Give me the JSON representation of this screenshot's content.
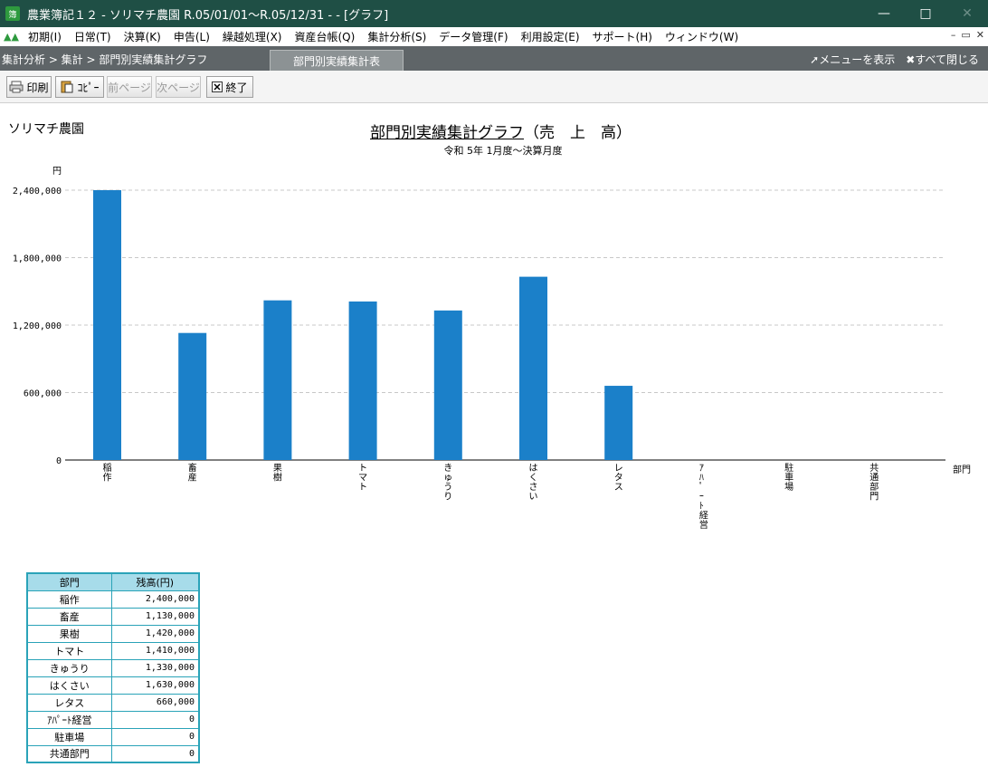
{
  "window": {
    "title": "農業簿記１２ - ソリマチ農園 R.05/01/01～R.05/12/31 - - [グラフ]",
    "app_icon_text": "簿"
  },
  "menu": {
    "items": [
      "初期(I)",
      "日常(T)",
      "決算(K)",
      "申告(L)",
      "繰越処理(X)",
      "資産台帳(Q)",
      "集計分析(S)",
      "データ管理(F)",
      "利用設定(E)",
      "サポート(H)",
      "ウィンドウ(W)"
    ]
  },
  "nav": {
    "breadcrumb": "集計分析 > 集計 > 部門別実績集計グラフ",
    "tab": "部門別実績集計表",
    "show_menu": "メニューを表示",
    "close_all": "すべて閉じる"
  },
  "toolbar": {
    "print": "印刷",
    "copy": "ｺﾋﾟｰ",
    "prev_page": "前ページ",
    "next_page": "次ページ",
    "exit": "終了"
  },
  "report": {
    "farm_name": "ソリマチ農園",
    "title": "部門別実績集計グラフ",
    "title_suffix": "（売　上　高）",
    "subtitle": "令和 5年 1月度～決算月度"
  },
  "chart_data": {
    "type": "bar",
    "ylabel": "円",
    "xlabel": "部門",
    "ylim": [
      0,
      2400000
    ],
    "ytick_labels": [
      "0",
      "600,000",
      "1,200,000",
      "1,800,000",
      "2,400,000"
    ],
    "yticks": [
      0,
      600000,
      1200000,
      1800000,
      2400000
    ],
    "categories": [
      "稲作",
      "畜産",
      "果樹",
      "トマト",
      "きゅうり",
      "はくさい",
      "レタス",
      "ｱﾊﾟｰﾄ経営",
      "駐車場",
      "共通部門"
    ],
    "values": [
      2400000,
      1130000,
      1420000,
      1410000,
      1330000,
      1630000,
      660000,
      0,
      0,
      0
    ],
    "bar_color": "#1b80c9",
    "grid": true
  },
  "table": {
    "headers": [
      "部門",
      "残高(円)"
    ],
    "rows": [
      [
        "稲作",
        "2,400,000"
      ],
      [
        "畜産",
        "1,130,000"
      ],
      [
        "果樹",
        "1,420,000"
      ],
      [
        "トマト",
        "1,410,000"
      ],
      [
        "きゅうり",
        "1,330,000"
      ],
      [
        "はくさい",
        "1,630,000"
      ],
      [
        "レタス",
        "660,000"
      ],
      [
        "ｱﾊﾟｰﾄ経営",
        "0"
      ],
      [
        "駐車場",
        "0"
      ],
      [
        "共通部門",
        "0"
      ]
    ]
  }
}
